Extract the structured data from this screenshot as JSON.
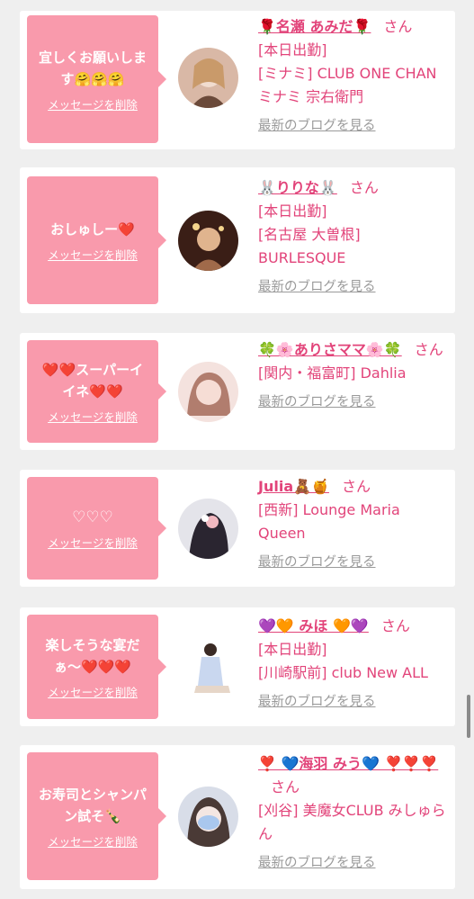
{
  "delete_label": "メッセージを削除",
  "blog_label": "最新のブログを見る",
  "san_label": "さん",
  "items": [
    {
      "message": "宜しくお願いします🤗🤗🤗",
      "name": "🌹名瀬 あみだ🌹",
      "details": "[本日出勤]\n[ミナミ] CLUB ONE CHAN ミナミ 宗右衛門",
      "avatar_colors": [
        "#e9d3c6",
        "#6b4a3a"
      ]
    },
    {
      "message": "おしゅしー❤️",
      "name": "🐰りりな🐰",
      "details": "[本日出勤]\n[名古屋 大曽根] BURLESQUE",
      "avatar_colors": [
        "#3a1e16",
        "#d49a6a"
      ]
    },
    {
      "message": "❤️❤️スーパーイイネ❤️❤️",
      "name": "🍀🌸ありさママ🌸🍀",
      "details": "[関内・福富町] Dahlia",
      "avatar_colors": [
        "#f2d8d4",
        "#b17d6e"
      ]
    },
    {
      "message": "♡♡♡",
      "name": "Julia🧸🍯",
      "details": "[西新] Lounge Maria Queen",
      "avatar_colors": [
        "#e4e4ea",
        "#2a2530"
      ]
    },
    {
      "message": "楽しそうな宴だぁ〜❤️❤️❤️",
      "name": "💜🧡 みほ 🧡💜",
      "details": "[本日出勤]\n[川崎駅前] club New ALL",
      "avatar_colors": [
        "#ffffff",
        "#c9d7ef"
      ]
    },
    {
      "message": "お寿司とシャンパン試そ🍾",
      "name": "❣️ 💙海羽 みう💙 ❣️❣️❣️",
      "details": "[刈谷] 美魔女CLUB みしゅらん",
      "avatar_colors": [
        "#d8dde8",
        "#a9c7ee"
      ]
    }
  ]
}
